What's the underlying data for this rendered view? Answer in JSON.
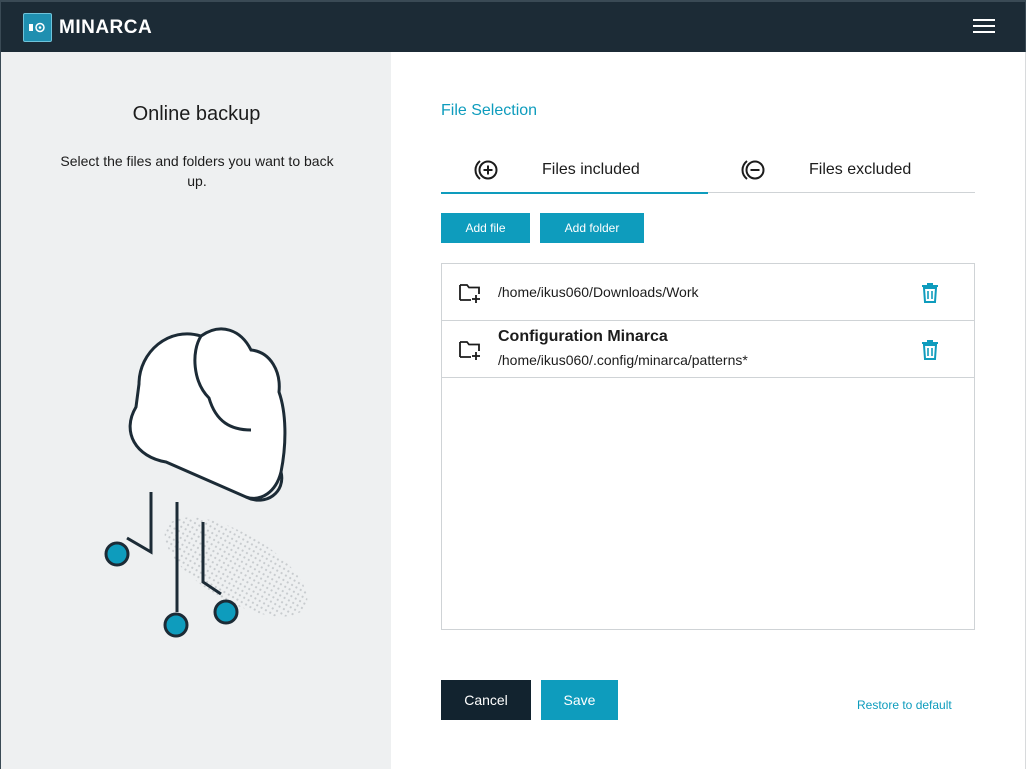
{
  "header": {
    "app_name": "MINARCA",
    "logo_icon": "minarca-logo-icon",
    "menu_icon": "hamburger-menu-icon"
  },
  "left_panel": {
    "title": "Online backup",
    "description": "Select the files and folders you want to back up.",
    "illustration": "cloud-network-illustration"
  },
  "main": {
    "section_title": "File Selection",
    "tabs": [
      {
        "label": "Files included",
        "icon": "circle-plus-icon",
        "active": true
      },
      {
        "label": "Files excluded",
        "icon": "circle-minus-icon",
        "active": false
      }
    ],
    "add_file_label": "Add file",
    "add_folder_label": "Add folder",
    "items": [
      {
        "title": "",
        "path": "/home/ikus060/Downloads/Work",
        "icon": "folder-plus-icon"
      },
      {
        "title": "Configuration Minarca",
        "path": "/home/ikus060/.config/minarca/patterns*",
        "icon": "folder-plus-icon"
      }
    ],
    "cancel_label": "Cancel",
    "save_label": "Save",
    "restore_label": "Restore to default"
  },
  "colors": {
    "accent": "#0e9cbd",
    "header_bg": "#1c2b36",
    "left_bg": "#eef0f1",
    "cancel_bg": "#12232f"
  }
}
